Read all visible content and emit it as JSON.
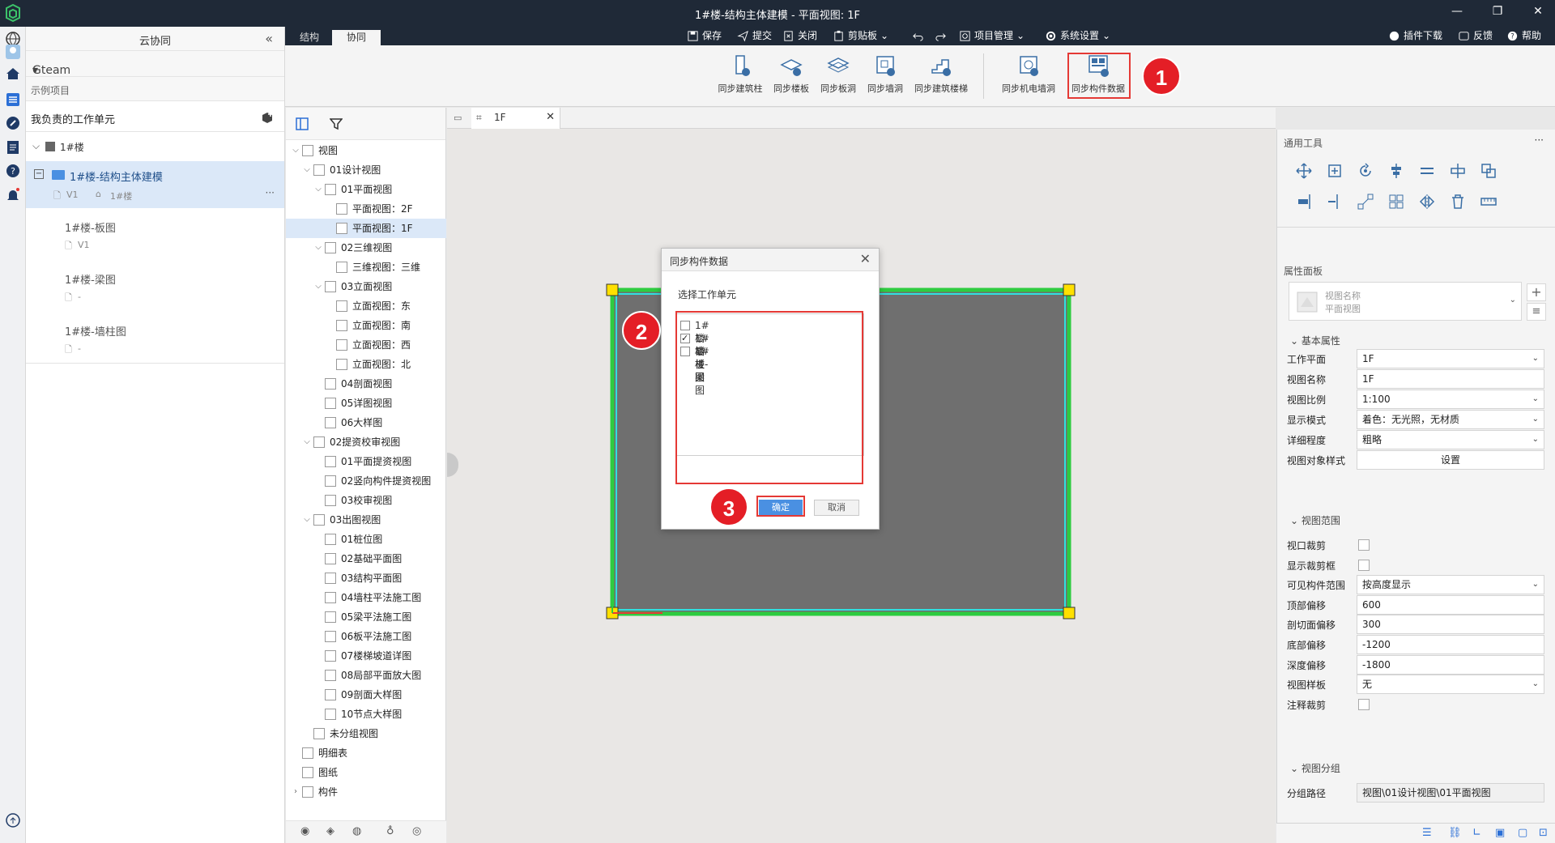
{
  "window": {
    "title": "1#楼-结构主体建模 - 平面视图: 1F",
    "controls": [
      "—",
      "❐",
      "✕"
    ]
  },
  "tabs": [
    {
      "label": "结构",
      "active": false
    },
    {
      "label": "协同",
      "active": true
    }
  ],
  "quickbar": {
    "save": "保存",
    "submit": "提交",
    "close": "关闭",
    "clipboard": "剪贴板",
    "project_mgmt": "项目管理",
    "settings": "系统设置"
  },
  "topright": {
    "plugin": "插件下载",
    "feedback": "反馈",
    "help": "帮助"
  },
  "ribbon": {
    "buttons": [
      {
        "label": "同步建筑柱",
        "icon": "sync-column-icon"
      },
      {
        "label": "同步楼板",
        "icon": "sync-floor-icon"
      },
      {
        "label": "同步板洞",
        "icon": "sync-slab-hole-icon"
      },
      {
        "label": "同步墙洞",
        "icon": "sync-wall-hole-icon"
      },
      {
        "label": "同步建筑楼梯",
        "icon": "sync-stairs-icon"
      },
      {
        "label": "同步机电墙洞",
        "icon": "sync-mep-hole-icon"
      },
      {
        "label": "同步构件数据",
        "icon": "sync-component-data-icon"
      }
    ]
  },
  "leftpanel": {
    "title": "云协同",
    "collapse": "«",
    "team": "Gteam",
    "project": "示例项目",
    "section_title": "我负责的工作单元",
    "building": "1#楼",
    "work_units": [
      {
        "name": "1#楼-结构主体建模",
        "version": "V1",
        "floor": "1#楼",
        "more": "···"
      },
      {
        "name": "1#楼-板图",
        "version": "V1"
      },
      {
        "name": "1#楼-梁图",
        "version": "-"
      },
      {
        "name": "1#楼-墙柱图",
        "version": "-"
      }
    ]
  },
  "tree": {
    "nodes": [
      {
        "label": "视图",
        "level": 0,
        "arrow": "⌵"
      },
      {
        "label": "01设计视图",
        "level": 1,
        "arrow": "⌵"
      },
      {
        "label": "01平面视图",
        "level": 2,
        "arrow": "⌵"
      },
      {
        "label": "平面视图：2F",
        "level": 3,
        "arrow": ""
      },
      {
        "label": "平面视图：1F",
        "level": 3,
        "arrow": "",
        "selected": true
      },
      {
        "label": "02三维视图",
        "level": 2,
        "arrow": "⌵"
      },
      {
        "label": "三维视图：三维",
        "level": 3,
        "arrow": ""
      },
      {
        "label": "03立面视图",
        "level": 2,
        "arrow": "⌵"
      },
      {
        "label": "立面视图：东",
        "level": 3,
        "arrow": ""
      },
      {
        "label": "立面视图：南",
        "level": 3,
        "arrow": ""
      },
      {
        "label": "立面视图：西",
        "level": 3,
        "arrow": ""
      },
      {
        "label": "立面视图：北",
        "level": 3,
        "arrow": ""
      },
      {
        "label": "04剖面视图",
        "level": 2,
        "arrow": ""
      },
      {
        "label": "05详图视图",
        "level": 2,
        "arrow": ""
      },
      {
        "label": "06大样图",
        "level": 2,
        "arrow": ""
      },
      {
        "label": "02提资校审视图",
        "level": 1,
        "arrow": "⌵"
      },
      {
        "label": "01平面提资视图",
        "level": 2,
        "arrow": ""
      },
      {
        "label": "02竖向构件提资视图",
        "level": 2,
        "arrow": ""
      },
      {
        "label": "03校审视图",
        "level": 2,
        "arrow": ""
      },
      {
        "label": "03出图视图",
        "level": 1,
        "arrow": "⌵"
      },
      {
        "label": "01桩位图",
        "level": 2,
        "arrow": ""
      },
      {
        "label": "02基础平面图",
        "level": 2,
        "arrow": ""
      },
      {
        "label": "03结构平面图",
        "level": 2,
        "arrow": ""
      },
      {
        "label": "04墙柱平法施工图",
        "level": 2,
        "arrow": ""
      },
      {
        "label": "05梁平法施工图",
        "level": 2,
        "arrow": ""
      },
      {
        "label": "06板平法施工图",
        "level": 2,
        "arrow": ""
      },
      {
        "label": "07楼梯坡道详图",
        "level": 2,
        "arrow": ""
      },
      {
        "label": "08局部平面放大图",
        "level": 2,
        "arrow": ""
      },
      {
        "label": "09剖面大样图",
        "level": 2,
        "arrow": ""
      },
      {
        "label": "10节点大样图",
        "level": 2,
        "arrow": ""
      },
      {
        "label": "未分组视图",
        "level": 1,
        "arrow": ""
      },
      {
        "label": "明细表",
        "level": 0,
        "arrow": ""
      },
      {
        "label": "图纸",
        "level": 0,
        "arrow": ""
      },
      {
        "label": "构件",
        "level": 0,
        "arrow": "›"
      }
    ]
  },
  "viewtab": {
    "label": "1F",
    "close": "✕"
  },
  "dialog": {
    "title": "同步构件数据",
    "close": "✕",
    "label": "选择工作单元",
    "options": [
      {
        "label": "1#楼-墙柱图",
        "checked": false
      },
      {
        "label": "1#楼-板图",
        "checked": true
      },
      {
        "label": "1#楼-梁图",
        "checked": false
      }
    ],
    "ok": "确定",
    "cancel": "取消"
  },
  "rightpanel": {
    "tools_title": "通用工具",
    "tools_more": "···",
    "props_title": "属性面板",
    "type_name": "视图名称",
    "type_value": "平面视图",
    "group_basic": "基本属性",
    "basic": [
      {
        "key": "工作平面",
        "value": "1F",
        "dropdown": true
      },
      {
        "key": "视图名称",
        "value": "1F",
        "dropdown": false
      },
      {
        "key": "视图比例",
        "value": "1:100",
        "dropdown": true
      },
      {
        "key": "显示模式",
        "value": "着色：无光照，无材质",
        "dropdown": true
      },
      {
        "key": "详细程度",
        "value": "粗略",
        "dropdown": true
      },
      {
        "key": "视图对象样式",
        "value": "设置",
        "dropdown": false,
        "button": true
      }
    ],
    "group_range": "视图范围",
    "range": [
      {
        "key": "视口裁剪",
        "checkbox": true
      },
      {
        "key": "显示裁剪框",
        "checkbox": true
      },
      {
        "key": "可见构件范围",
        "value": "按高度显示",
        "dropdown": true
      },
      {
        "key": "顶部偏移",
        "value": "600"
      },
      {
        "key": "剖切面偏移",
        "value": "300"
      },
      {
        "key": "底部偏移",
        "value": "-1200"
      },
      {
        "key": "深度偏移",
        "value": "-1800"
      },
      {
        "key": "视图样板",
        "value": "无",
        "dropdown": true
      },
      {
        "key": "注释裁剪",
        "checkbox": true
      }
    ],
    "group_group": "视图分组",
    "group_path_key": "分组路径",
    "group_path_value": "视图\\01设计视图\\01平面视图"
  },
  "annotations": {
    "badge1": "1",
    "badge2": "2",
    "badge3": "3",
    "color": "#e53935"
  }
}
